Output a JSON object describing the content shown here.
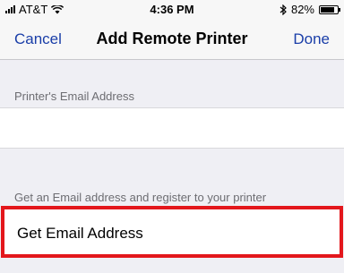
{
  "status_bar": {
    "carrier": "AT&T",
    "time": "4:36 PM",
    "battery_percent": "82%",
    "battery_level": 0.82
  },
  "nav": {
    "cancel_label": "Cancel",
    "title": "Add Remote Printer",
    "done_label": "Done"
  },
  "form": {
    "email_section_header": "Printer's Email Address",
    "email_value": "",
    "get_email_section_header": "Get an Email address and register to your printer",
    "get_email_label": "Get Email Address"
  },
  "colors": {
    "accent": "#1a3ea8",
    "highlight": "#e3171c",
    "background": "#efeff4"
  }
}
